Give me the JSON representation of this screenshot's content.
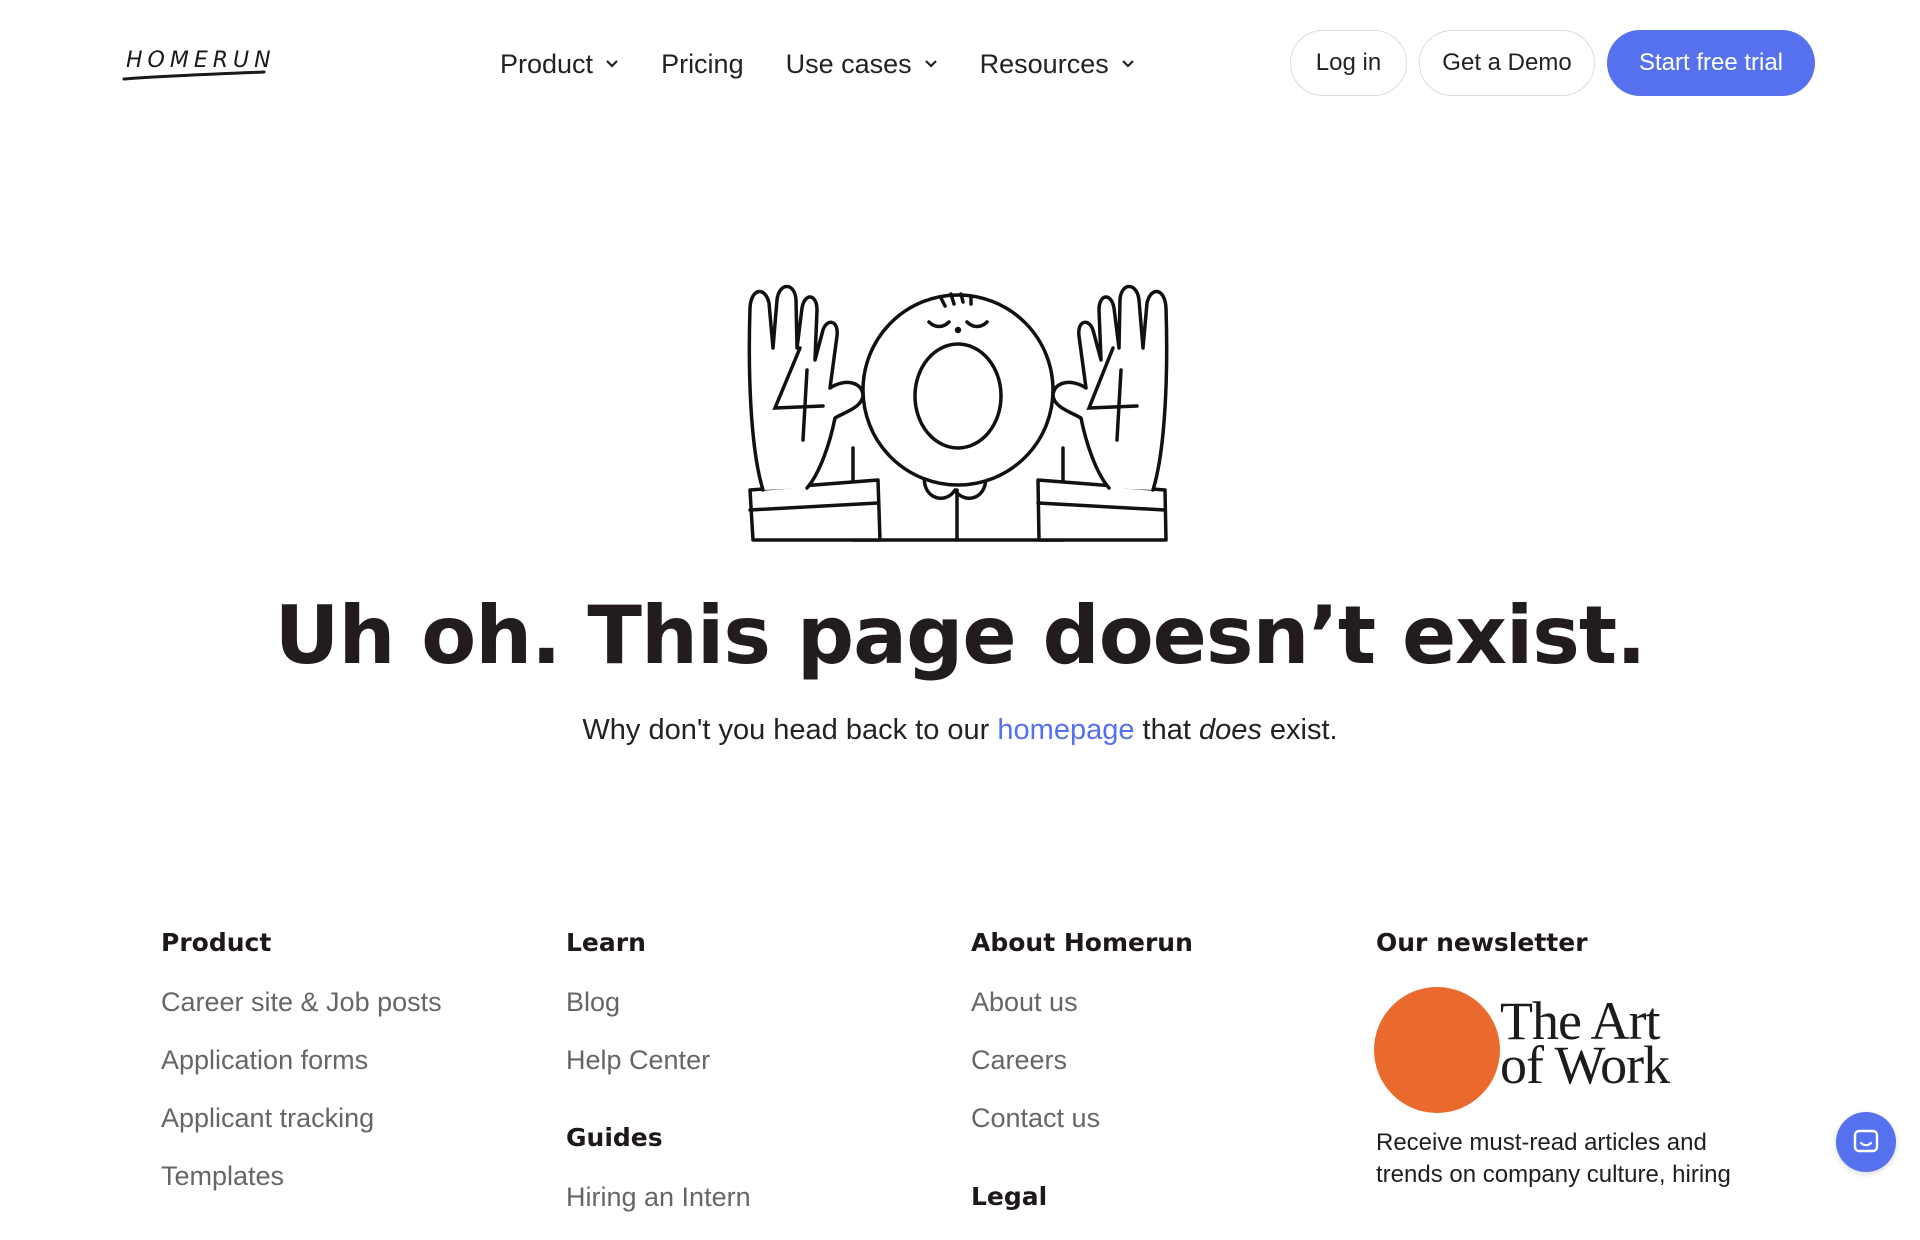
{
  "header": {
    "logo_text": "HOMERUN",
    "nav": [
      {
        "label": "Product",
        "dropdown": true
      },
      {
        "label": "Pricing",
        "dropdown": false
      },
      {
        "label": "Use cases",
        "dropdown": true
      },
      {
        "label": "Resources",
        "dropdown": true
      }
    ],
    "login_label": "Log in",
    "demo_label": "Get a Demo",
    "trial_label": "Start free trial"
  },
  "hero": {
    "illustration": "404-character-illustration",
    "headline": "Uh oh. This page doesn’t exist.",
    "sub_before": "Why don't you head back to our ",
    "sub_link": "homepage",
    "sub_middle": " that ",
    "sub_emphasis": "does",
    "sub_after": " exist."
  },
  "footer": {
    "product": {
      "heading": "Product",
      "links": [
        "Career site & Job posts",
        "Application forms",
        "Applicant tracking",
        "Templates"
      ]
    },
    "learn": {
      "heading": "Learn",
      "links": [
        "Blog",
        "Help Center"
      ]
    },
    "guides": {
      "heading": "Guides",
      "links": [
        "Hiring an Intern"
      ]
    },
    "about": {
      "heading": "About Homerun",
      "links": [
        "About us",
        "Careers",
        "Contact us"
      ]
    },
    "legal": {
      "heading": "Legal"
    },
    "newsletter": {
      "heading": "Our newsletter",
      "logo_line1": "The Art",
      "logo_line2": "of Work",
      "description": "Receive must-read articles and trends on company culture, hiring"
    }
  },
  "colors": {
    "accent": "#5671ee",
    "newsletter_circle": "#ea6a2d",
    "text_dark": "#221c1c",
    "text_muted": "#666666"
  },
  "chat_widget": {
    "icon": "chat-icon"
  }
}
